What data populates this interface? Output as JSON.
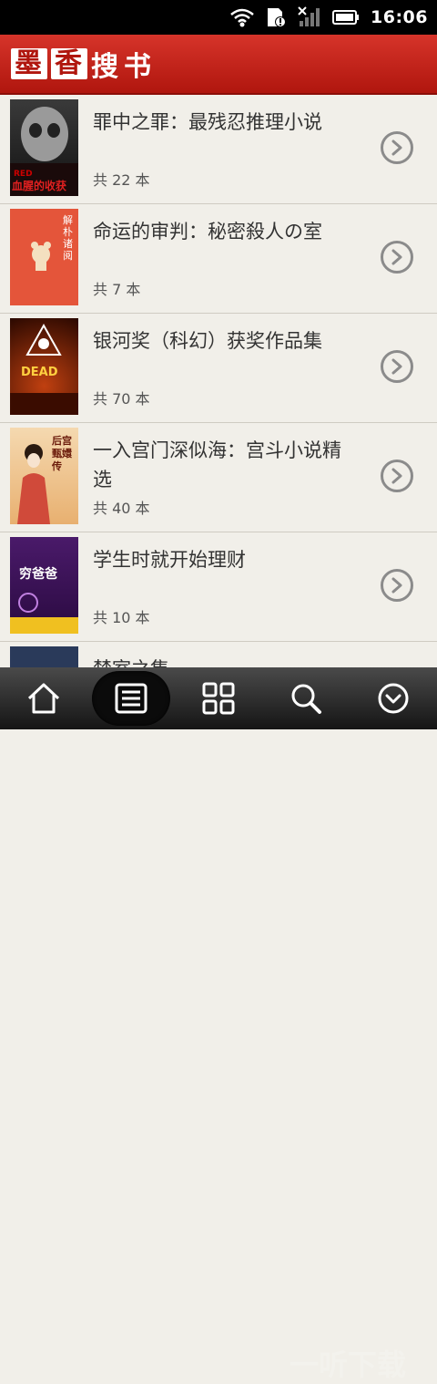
{
  "status": {
    "time": "16:06"
  },
  "header": {
    "logo_chars": [
      "墨",
      "香",
      "搜",
      "书"
    ]
  },
  "books": [
    {
      "title": "罪中之罪：最残忍推理小说",
      "count": "共 22 本",
      "cover_text": "血腥的收获"
    },
    {
      "title": "命运的审判：秘密殺人の室",
      "count": "共 7 本",
      "cover_text": "解朴诸阅"
    },
    {
      "title": "银河奖（科幻）获奖作品集",
      "count": "共 70 本",
      "cover_text": "DEAD"
    },
    {
      "title": "一入宫门深似海：宫斗小说精选",
      "count": "共 40 本",
      "cover_text": "后宫甄嬛传"
    },
    {
      "title": "学生时就开始理财",
      "count": "共 10 本",
      "cover_text": "穷爸爸"
    },
    {
      "title": "禁室之集",
      "count": "",
      "cover_text": ""
    }
  ],
  "nav": {
    "watermark": "一听下载"
  },
  "colors": {
    "header": "#c41f16",
    "background": "#f1efe9",
    "chevron": "#8b8b8b"
  }
}
